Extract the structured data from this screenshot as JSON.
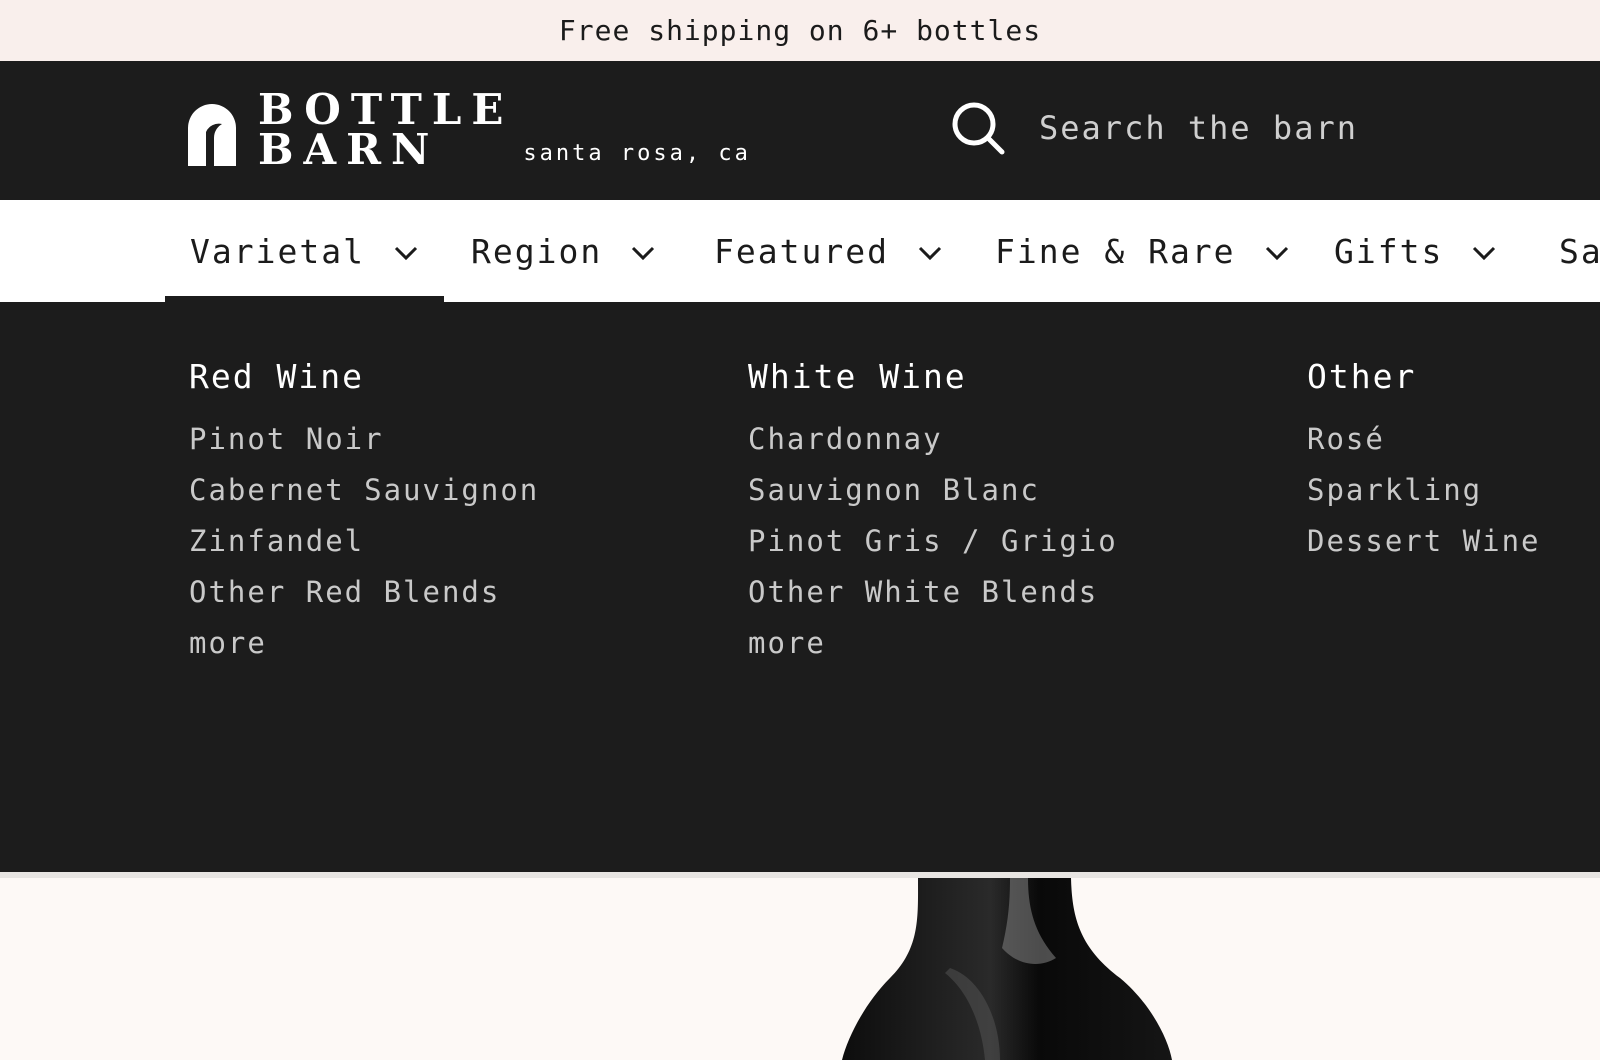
{
  "announcement": "Free shipping on 6+ bottles",
  "brand": {
    "line1": "BOTTLE",
    "line2": "BARN",
    "location": "santa rosa, ca"
  },
  "search": {
    "placeholder": "Search the barn",
    "icon": "search-icon"
  },
  "nav": {
    "items": [
      {
        "label": "Varietal",
        "active": true
      },
      {
        "label": "Region"
      },
      {
        "label": "Featured"
      },
      {
        "label": "Fine & Rare"
      },
      {
        "label": "Gifts"
      },
      {
        "label": "Sale"
      }
    ]
  },
  "mega_menu": {
    "columns": [
      {
        "title": "Red Wine",
        "links": [
          "Pinot Noir",
          "Cabernet Sauvignon",
          "Zinfandel",
          "Other Red Blends",
          "more"
        ]
      },
      {
        "title": "White Wine",
        "links": [
          "Chardonnay",
          "Sauvignon Blanc",
          "Pinot Gris / Grigio",
          "Other White Blends",
          "more"
        ]
      },
      {
        "title": "Other",
        "links": [
          "Rosé",
          "Sparkling",
          "Dessert Wine"
        ]
      }
    ]
  },
  "colors": {
    "dark": "#1c1c1c",
    "announcement_bg": "#f9efec",
    "page_bg": "#fdf9f6"
  }
}
